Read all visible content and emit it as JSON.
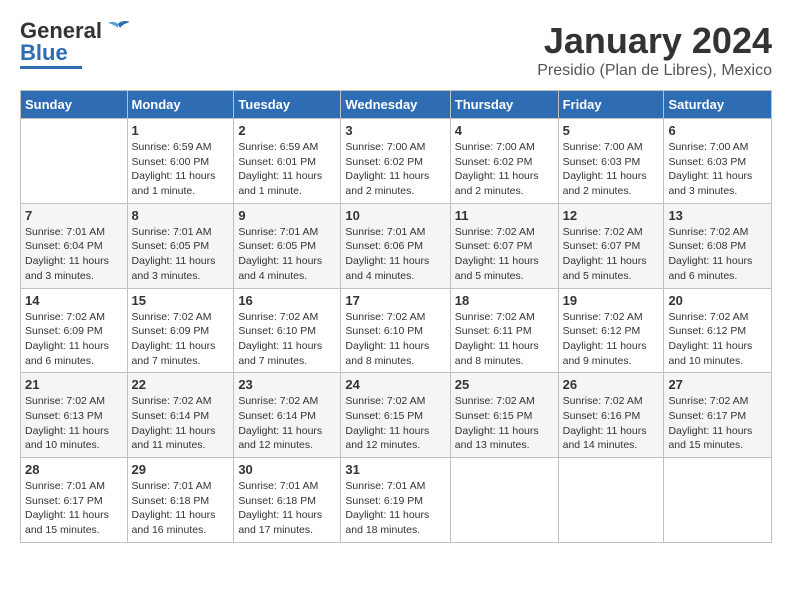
{
  "header": {
    "logo": {
      "general": "General",
      "blue": "Blue"
    },
    "title": "January 2024",
    "location": "Presidio (Plan de Libres), Mexico"
  },
  "calendar": {
    "weekdays": [
      "Sunday",
      "Monday",
      "Tuesday",
      "Wednesday",
      "Thursday",
      "Friday",
      "Saturday"
    ],
    "weeks": [
      [
        {
          "day": "",
          "info": ""
        },
        {
          "day": "1",
          "info": "Sunrise: 6:59 AM\nSunset: 6:00 PM\nDaylight: 11 hours\nand 1 minute."
        },
        {
          "day": "2",
          "info": "Sunrise: 6:59 AM\nSunset: 6:01 PM\nDaylight: 11 hours\nand 1 minute."
        },
        {
          "day": "3",
          "info": "Sunrise: 7:00 AM\nSunset: 6:02 PM\nDaylight: 11 hours\nand 2 minutes."
        },
        {
          "day": "4",
          "info": "Sunrise: 7:00 AM\nSunset: 6:02 PM\nDaylight: 11 hours\nand 2 minutes."
        },
        {
          "day": "5",
          "info": "Sunrise: 7:00 AM\nSunset: 6:03 PM\nDaylight: 11 hours\nand 2 minutes."
        },
        {
          "day": "6",
          "info": "Sunrise: 7:00 AM\nSunset: 6:03 PM\nDaylight: 11 hours\nand 3 minutes."
        }
      ],
      [
        {
          "day": "7",
          "info": "Sunrise: 7:01 AM\nSunset: 6:04 PM\nDaylight: 11 hours\nand 3 minutes."
        },
        {
          "day": "8",
          "info": "Sunrise: 7:01 AM\nSunset: 6:05 PM\nDaylight: 11 hours\nand 3 minutes."
        },
        {
          "day": "9",
          "info": "Sunrise: 7:01 AM\nSunset: 6:05 PM\nDaylight: 11 hours\nand 4 minutes."
        },
        {
          "day": "10",
          "info": "Sunrise: 7:01 AM\nSunset: 6:06 PM\nDaylight: 11 hours\nand 4 minutes."
        },
        {
          "day": "11",
          "info": "Sunrise: 7:02 AM\nSunset: 6:07 PM\nDaylight: 11 hours\nand 5 minutes."
        },
        {
          "day": "12",
          "info": "Sunrise: 7:02 AM\nSunset: 6:07 PM\nDaylight: 11 hours\nand 5 minutes."
        },
        {
          "day": "13",
          "info": "Sunrise: 7:02 AM\nSunset: 6:08 PM\nDaylight: 11 hours\nand 6 minutes."
        }
      ],
      [
        {
          "day": "14",
          "info": "Sunrise: 7:02 AM\nSunset: 6:09 PM\nDaylight: 11 hours\nand 6 minutes."
        },
        {
          "day": "15",
          "info": "Sunrise: 7:02 AM\nSunset: 6:09 PM\nDaylight: 11 hours\nand 7 minutes."
        },
        {
          "day": "16",
          "info": "Sunrise: 7:02 AM\nSunset: 6:10 PM\nDaylight: 11 hours\nand 7 minutes."
        },
        {
          "day": "17",
          "info": "Sunrise: 7:02 AM\nSunset: 6:10 PM\nDaylight: 11 hours\nand 8 minutes."
        },
        {
          "day": "18",
          "info": "Sunrise: 7:02 AM\nSunset: 6:11 PM\nDaylight: 11 hours\nand 8 minutes."
        },
        {
          "day": "19",
          "info": "Sunrise: 7:02 AM\nSunset: 6:12 PM\nDaylight: 11 hours\nand 9 minutes."
        },
        {
          "day": "20",
          "info": "Sunrise: 7:02 AM\nSunset: 6:12 PM\nDaylight: 11 hours\nand 10 minutes."
        }
      ],
      [
        {
          "day": "21",
          "info": "Sunrise: 7:02 AM\nSunset: 6:13 PM\nDaylight: 11 hours\nand 10 minutes."
        },
        {
          "day": "22",
          "info": "Sunrise: 7:02 AM\nSunset: 6:14 PM\nDaylight: 11 hours\nand 11 minutes."
        },
        {
          "day": "23",
          "info": "Sunrise: 7:02 AM\nSunset: 6:14 PM\nDaylight: 11 hours\nand 12 minutes."
        },
        {
          "day": "24",
          "info": "Sunrise: 7:02 AM\nSunset: 6:15 PM\nDaylight: 11 hours\nand 12 minutes."
        },
        {
          "day": "25",
          "info": "Sunrise: 7:02 AM\nSunset: 6:15 PM\nDaylight: 11 hours\nand 13 minutes."
        },
        {
          "day": "26",
          "info": "Sunrise: 7:02 AM\nSunset: 6:16 PM\nDaylight: 11 hours\nand 14 minutes."
        },
        {
          "day": "27",
          "info": "Sunrise: 7:02 AM\nSunset: 6:17 PM\nDaylight: 11 hours\nand 15 minutes."
        }
      ],
      [
        {
          "day": "28",
          "info": "Sunrise: 7:01 AM\nSunset: 6:17 PM\nDaylight: 11 hours\nand 15 minutes."
        },
        {
          "day": "29",
          "info": "Sunrise: 7:01 AM\nSunset: 6:18 PM\nDaylight: 11 hours\nand 16 minutes."
        },
        {
          "day": "30",
          "info": "Sunrise: 7:01 AM\nSunset: 6:18 PM\nDaylight: 11 hours\nand 17 minutes."
        },
        {
          "day": "31",
          "info": "Sunrise: 7:01 AM\nSunset: 6:19 PM\nDaylight: 11 hours\nand 18 minutes."
        },
        {
          "day": "",
          "info": ""
        },
        {
          "day": "",
          "info": ""
        },
        {
          "day": "",
          "info": ""
        }
      ]
    ]
  }
}
